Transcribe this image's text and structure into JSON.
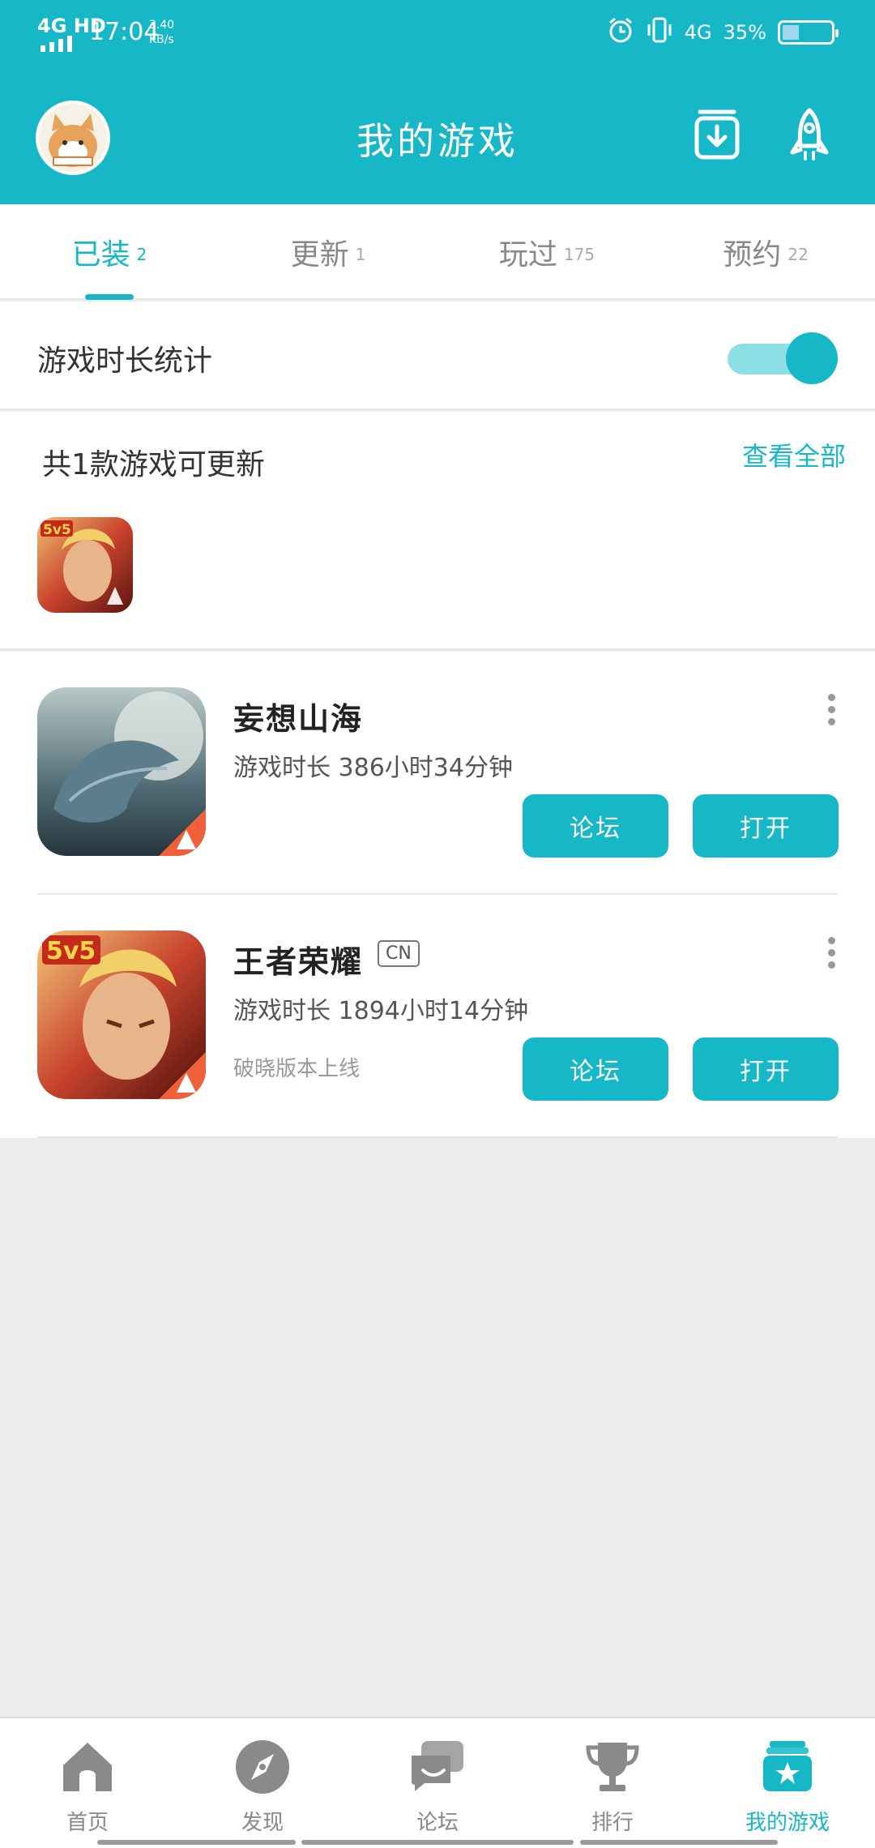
{
  "status_bar": {
    "network": "4G HD",
    "time": "17:04",
    "speed_value": "3.40",
    "speed_unit": "KB/s",
    "network2": "4G",
    "battery_percent": "35%",
    "battery_level": 0.35
  },
  "header": {
    "title": "我的游戏",
    "avatar_icon": "avatar-hamster",
    "download_icon": "download-manager-icon",
    "rocket_icon": "rocket-icon"
  },
  "tabs": [
    {
      "label": "已装",
      "count": "2",
      "active": true
    },
    {
      "label": "更新",
      "count": "1",
      "active": false
    },
    {
      "label": "玩过",
      "count": "175",
      "active": false
    },
    {
      "label": "预约",
      "count": "22",
      "active": false
    }
  ],
  "stat_toggle": {
    "label": "游戏时长统计",
    "on": true
  },
  "update_section": {
    "title": "共1款游戏可更新",
    "view_all": "查看全部",
    "icons": [
      "wangzhe-icon"
    ]
  },
  "games": [
    {
      "name": "妄想山海",
      "tag": "",
      "playtime_label": "游戏时长",
      "playtime_value": "386小时34分钟",
      "note": "",
      "forum_label": "论坛",
      "open_label": "打开"
    },
    {
      "name": "王者荣耀",
      "tag": "CN",
      "playtime_label": "游戏时长",
      "playtime_value": "1894小时14分钟",
      "note": "破晓版本上线",
      "forum_label": "论坛",
      "open_label": "打开"
    }
  ],
  "bottom_nav": [
    {
      "label": "首页",
      "icon": "home-icon",
      "active": false
    },
    {
      "label": "发现",
      "icon": "compass-icon",
      "active": false
    },
    {
      "label": "论坛",
      "icon": "chat-icon",
      "active": false
    },
    {
      "label": "排行",
      "icon": "trophy-icon",
      "active": false
    },
    {
      "label": "我的游戏",
      "icon": "my-games-icon",
      "active": true
    }
  ],
  "colors": {
    "accent": "#16b8c8",
    "accent_light": "#8ddfe6",
    "background": "#ededed"
  }
}
